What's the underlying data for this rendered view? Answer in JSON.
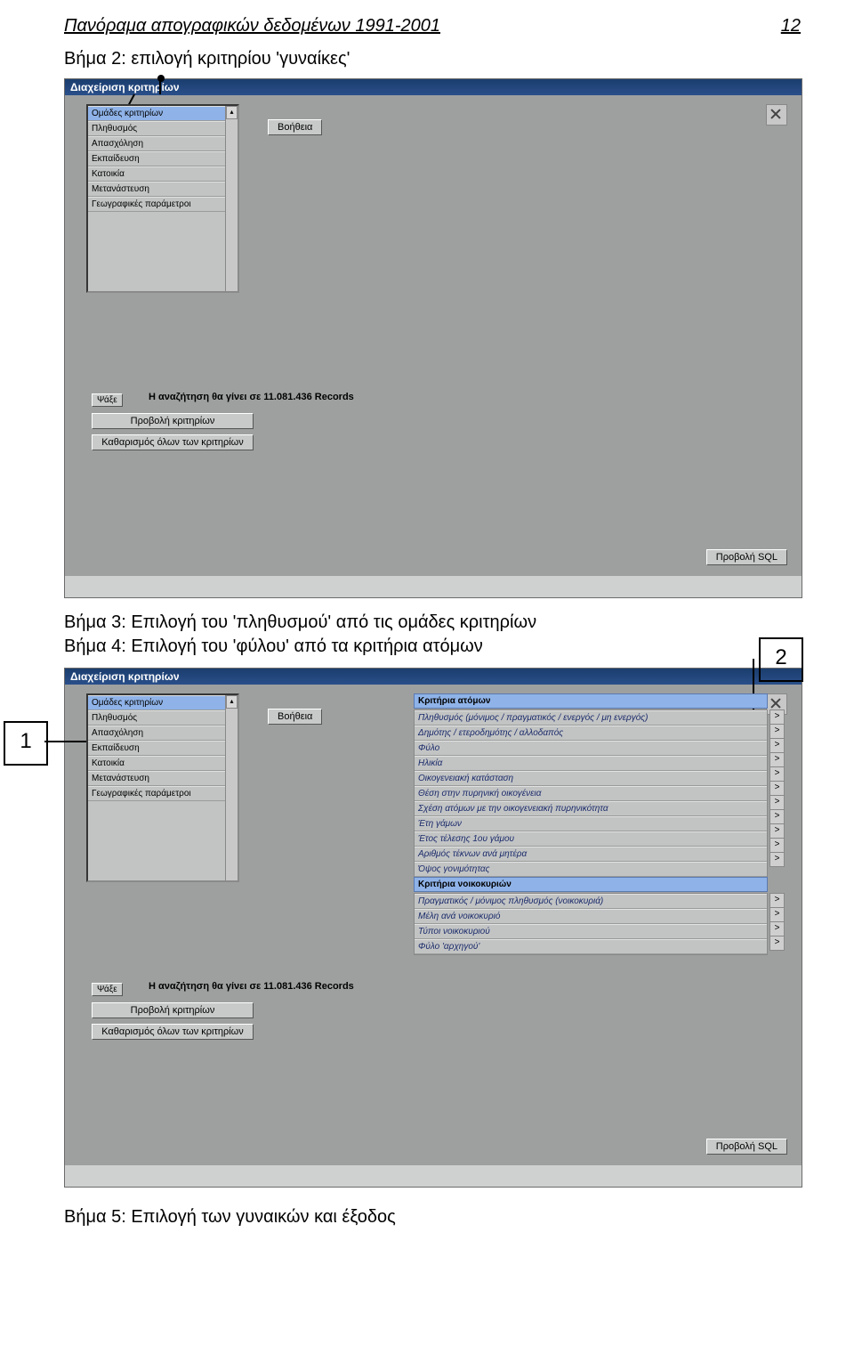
{
  "page": {
    "header_left": "Πανόραμα απογραφικών δεδομένων 1991-2001",
    "header_right": "12",
    "step2_title": "Βήμα 2: επιλογή κριτηρίου 'γυναίκες'",
    "step3_title": "Βήμα 3: Επιλογή του 'πληθυσμού' από τις ομάδες κριτηρίων",
    "step4_title": "Βήμα 4: Επιλογή του 'φύλου' από τα κριτήρια ατόμων",
    "step5_title": "Βήμα 5: Επιλογή των γυναικών και έξοδος",
    "label1": "1",
    "label2": "2"
  },
  "ui": {
    "window_title": "Διαχείριση κριτηρίων",
    "help_label": "Βοήθεια",
    "search_label": "Ψάξε",
    "search_note": "Η αναζήτηση θα γίνει σε 11.081.436 Records",
    "view_criteria_label": "Προβολή κριτηρίων",
    "clear_all_label": "Καθαρισμός όλων των κριτηρίων",
    "sql_label": "Προβολή SQL",
    "expand": ">",
    "scroll_up": "▴",
    "scroll_down": "▾"
  },
  "screenshot1": {
    "groups": [
      "Ομάδες κριτηρίων",
      "Πληθυσμός",
      "Απασχόληση",
      "Εκπαίδευση",
      "Κατοικία",
      "Μετανάστευση",
      "Γεωγραφικές παράμετροι"
    ]
  },
  "screenshot2": {
    "groups": [
      "Ομάδες κριτηρίων",
      "Πληθυσμός",
      "Απασχόληση",
      "Εκπαίδευση",
      "Κατοικία",
      "Μετανάστευση",
      "Γεωγραφικές παράμετροι"
    ],
    "persons_header": "Κριτήρια ατόμων",
    "persons": [
      "Πληθυσμός (μόνιμος / πραγματικός / ενεργός / μη ενεργός)",
      "Δημότης / ετεροδημότης / αλλοδαπός",
      "Φύλο",
      "Ηλικία",
      "Οικογενειακή κατάσταση",
      "Θέση στην πυρηνική οικογένεια",
      "Σχέση ατόμων με την οικογενειακή πυρηνικότητα",
      "Έτη γάμων",
      "Έτος τέλεσης 1ου γάμου",
      "Αριθμός τέκνων ανά μητέρα",
      "Όψος γονιμότητας"
    ],
    "households_header": "Κριτήρια νοικοκυριών",
    "households": [
      "Πραγματικός / μόνιμος πληθυσμός (νοικοκυριά)",
      "Μέλη ανά νοικοκυριό",
      "Τύποι νοικοκυριού",
      "Φύλο 'αρχηγού'"
    ]
  }
}
